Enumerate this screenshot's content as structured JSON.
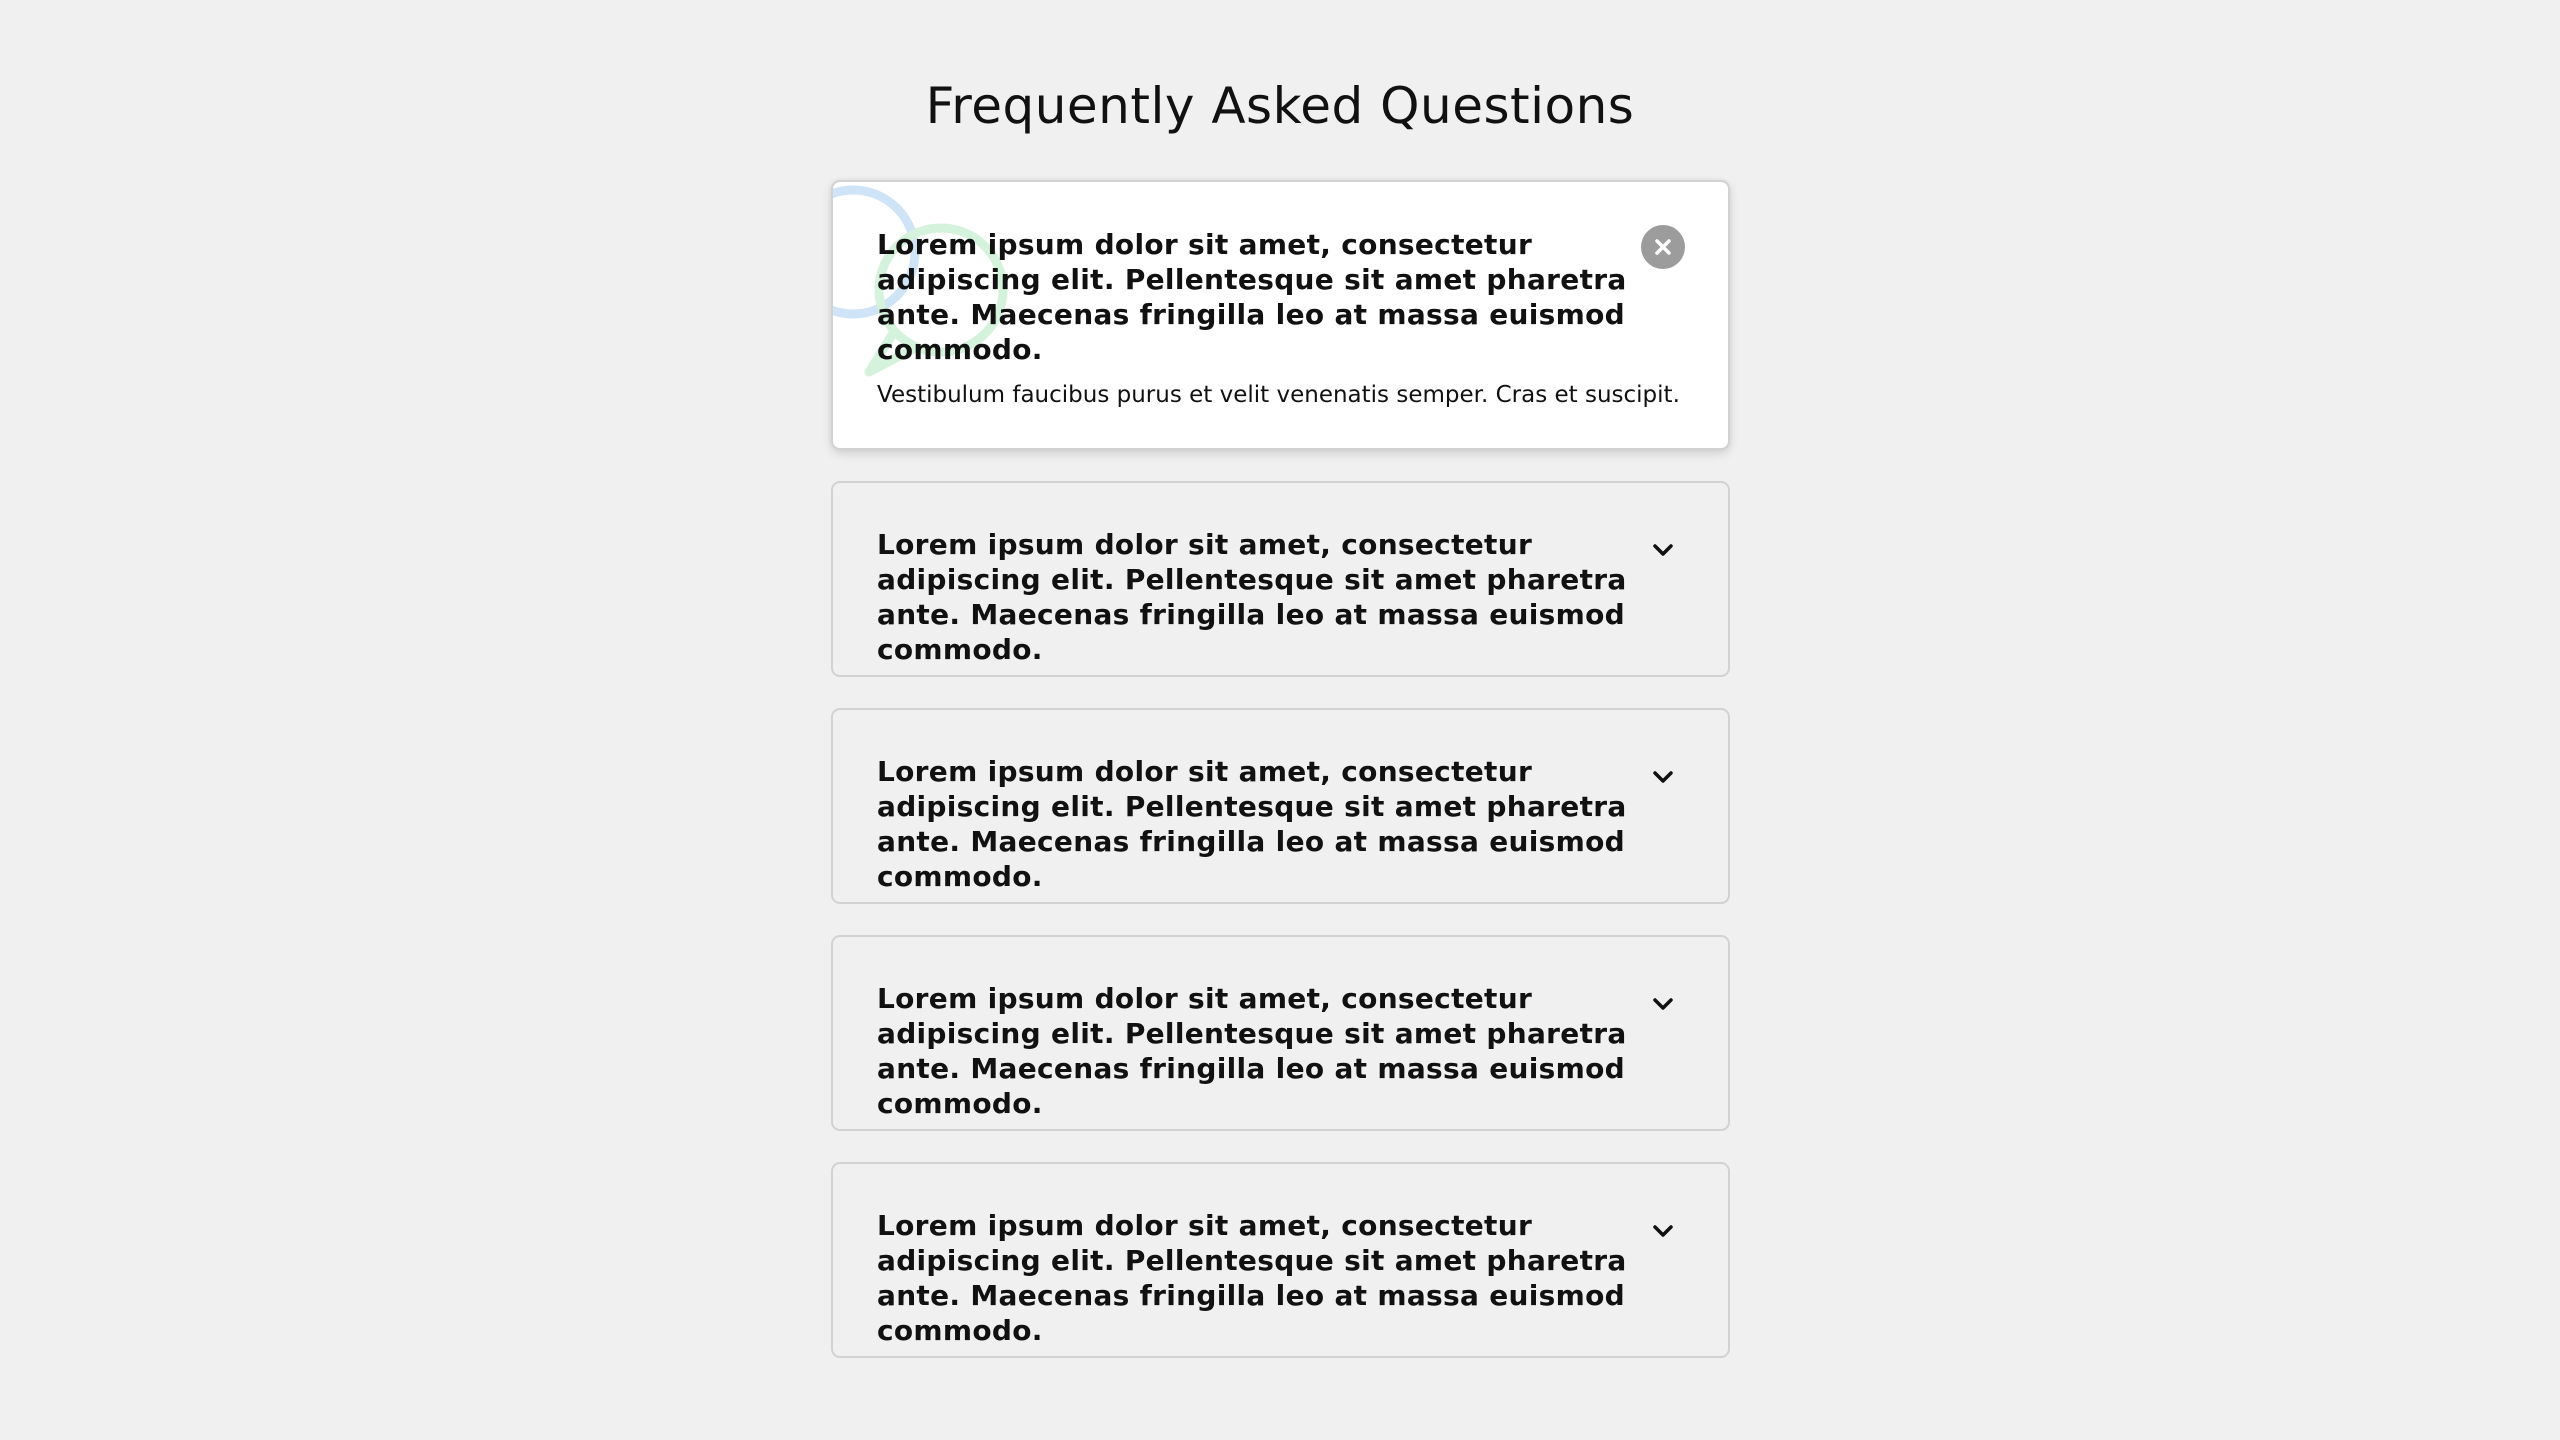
{
  "page": {
    "title": "Frequently Asked Questions"
  },
  "faq": {
    "items": [
      {
        "question": "Lorem ipsum dolor sit amet, consectetur adipiscing elit. Pellentesque sit amet pharetra ante. Maecenas fringilla leo at massa euismod commodo.",
        "answer": "Vestibulum faucibus purus et velit venenatis semper. Cras et suscipit.",
        "state": "expanded",
        "toggle_icon": "close-icon"
      },
      {
        "question": "Lorem ipsum dolor sit amet, consectetur adipiscing elit. Pellentesque sit amet pharetra ante. Maecenas fringilla leo at massa euismod commodo.",
        "state": "collapsed",
        "toggle_icon": "chevron-down-icon"
      },
      {
        "question": "Lorem ipsum dolor sit amet, consectetur adipiscing elit. Pellentesque sit amet pharetra ante. Maecenas fringilla leo at massa euismod commodo.",
        "state": "collapsed",
        "toggle_icon": "chevron-down-icon"
      },
      {
        "question": "Lorem ipsum dolor sit amet, consectetur adipiscing elit. Pellentesque sit amet pharetra ante. Maecenas fringilla leo at massa euismod commodo.",
        "state": "collapsed",
        "toggle_icon": "chevron-down-icon"
      },
      {
        "question": "Lorem ipsum dolor sit amet, consectetur adipiscing elit. Pellentesque sit amet pharetra ante. Maecenas fringilla leo at massa euismod commodo.",
        "state": "collapsed",
        "toggle_icon": "chevron-down-icon"
      }
    ]
  },
  "colors": {
    "page_background": "#f0f0f0",
    "active_card_background": "#ffffff",
    "card_border": "#d2d2d2",
    "close_button": "#9c9c9c",
    "bubble_blue": "#cfe4f6",
    "bubble_green": "#d4f2dc"
  },
  "decoration": {
    "icon": "speech-bubbles-icon"
  }
}
